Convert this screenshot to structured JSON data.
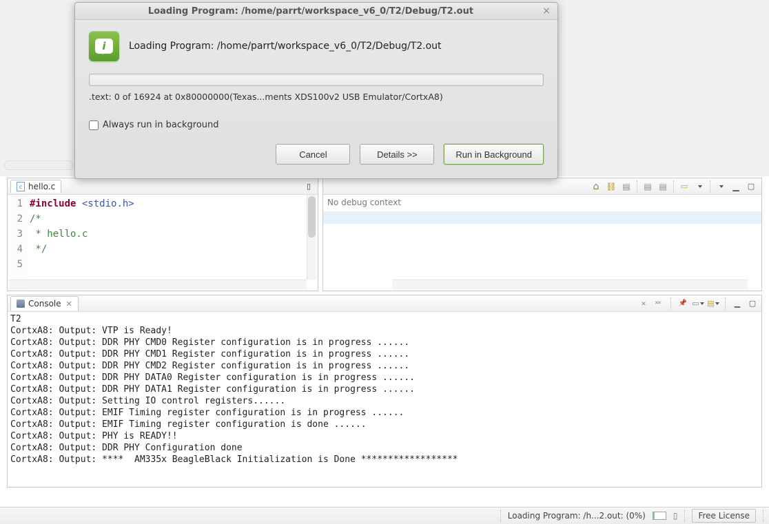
{
  "dialog": {
    "title": "Loading Program: /home/parrt/workspace_v6_0/T2/Debug/T2.out",
    "heading": "Loading Program: /home/parrt/workspace_v6_0/T2/Debug/T2.out",
    "progressText": ".text: 0 of 16924 at 0x80000000(Texas...ments XDS100v2 USB Emulator/CortxA8)",
    "alwaysBgLabel": "Always run in background",
    "cancel": "Cancel",
    "details": "Details >>",
    "runBg": "Run in Background"
  },
  "editor": {
    "tabName": "hello.c",
    "lines": {
      "l1a": "#include",
      "l1b": " <stdio.h>",
      "l2": "",
      "l3": "/*",
      "l4": " * hello.c",
      "l5": " */"
    },
    "gutter": [
      "1",
      "2",
      "3",
      "4",
      "5"
    ]
  },
  "rightPane": {
    "noDebug": "No debug context"
  },
  "console": {
    "tabName": "Console",
    "title": "T2",
    "lines": [
      "CortxA8: Output: VTP is Ready!",
      "CortxA8: Output: DDR PHY CMD0 Register configuration is in progress ......",
      "CortxA8: Output: DDR PHY CMD1 Register configuration is in progress ......",
      "CortxA8: Output: DDR PHY CMD2 Register configuration is in progress ......",
      "CortxA8: Output: DDR PHY DATA0 Register configuration is in progress ......",
      "CortxA8: Output: DDR PHY DATA1 Register configuration is in progress ......",
      "CortxA8: Output: Setting IO control registers......",
      "CortxA8: Output: EMIF Timing register configuration is in progress ......",
      "CortxA8: Output: EMIF Timing register configuration is done ......",
      "CortxA8: Output: PHY is READY!!",
      "CortxA8: Output: DDR PHY Configuration done",
      "CortxA8: Output: ****  AM335x BeagleBlack Initialization is Done ******************"
    ]
  },
  "statusbar": {
    "loading": "Loading Program: /h...2.out: (0%)",
    "license": "Free License"
  }
}
